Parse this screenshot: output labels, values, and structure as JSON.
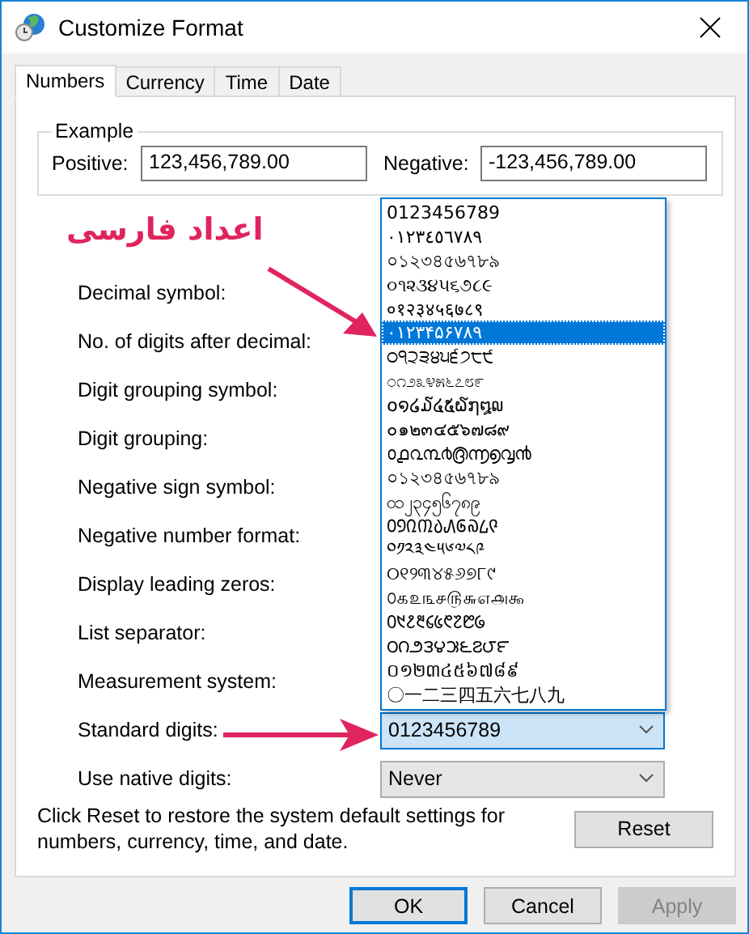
{
  "window": {
    "title": "Customize Format"
  },
  "tabs": [
    {
      "label": "Numbers",
      "selected": true
    },
    {
      "label": "Currency",
      "selected": false
    },
    {
      "label": "Time",
      "selected": false
    },
    {
      "label": "Date",
      "selected": false
    }
  ],
  "example": {
    "title": "Example",
    "positive_label": "Positive:",
    "positive_value": "123,456,789.00",
    "negative_label": "Negative:",
    "negative_value": "-123,456,789.00"
  },
  "settings": [
    {
      "label": "Decimal symbol:"
    },
    {
      "label": "No. of digits after decimal:"
    },
    {
      "label": "Digit grouping symbol:"
    },
    {
      "label": "Digit grouping:"
    },
    {
      "label": "Negative sign symbol:"
    },
    {
      "label": "Negative number format:"
    },
    {
      "label": "Display leading zeros:"
    },
    {
      "label": "List separator:"
    },
    {
      "label": "Measurement system:"
    },
    {
      "label": "Standard digits:",
      "value": "0123456789",
      "focused": true
    },
    {
      "label": "Use native digits:",
      "value": "Never",
      "focused": false
    }
  ],
  "digit_list": [
    {
      "text": "0123456789",
      "selected": false
    },
    {
      "text": "٠١٢٣٤٥٦٧٨٩",
      "selected": false
    },
    {
      "text": "০১২৩৪৫৬৭৮৯",
      "selected": false
    },
    {
      "text": "૦૧૨૩૪૫૬૭૮૯",
      "selected": false
    },
    {
      "text": "०१२३४५६७८९",
      "selected": false
    },
    {
      "text": "۰۱۲۳۴۵۶۷۸۹",
      "selected": true
    },
    {
      "text": "੦੧੨੩੪੫੬੭੮੯",
      "selected": false
    },
    {
      "text": "೦೧೨೩೪೫೬೭೮೯",
      "selected": false
    },
    {
      "text": "໐໑໒໓໔໕໖໗໘໙",
      "selected": false
    },
    {
      "text": "๐๑๒๓๔๕๖๗๘๙",
      "selected": false
    },
    {
      "text": "൦൧൨൩൪൫൬൭൮൯",
      "selected": false
    },
    {
      "text": "০১২৩৪৫৬৭৮৯",
      "selected": false
    },
    {
      "text": "၀၁၂၃၄၅၆၇၈၉",
      "selected": false
    },
    {
      "text": "᠐᠑᠒᠓᠔᠕᠖᠗᠘᠙",
      "selected": false
    },
    {
      "text": "༠༡༢༣༤༥༦༧༨༩",
      "selected": false
    },
    {
      "text": "୦୧୨୩୪୫୬୭୮୯",
      "selected": false
    },
    {
      "text": "௦௧௨௩௪௫௬௭௮௯",
      "selected": false
    },
    {
      "text": "᱐᱑᱒᱓᱔᱕᱖᱗᱘᱙",
      "selected": false
    },
    {
      "text": "౦౧౨౩౪౫౬౭౮౯",
      "selected": false
    },
    {
      "text": "០១២៣៤៥៦៧៨៩",
      "selected": false
    },
    {
      "text": "〇一二三四五六七八九",
      "selected": false
    }
  ],
  "reset_note": "Click Reset to restore the system default settings for numbers, currency, time, and date.",
  "reset_button": {
    "label": "Reset"
  },
  "buttons": [
    {
      "label": "OK",
      "kind": "default",
      "disabled": false
    },
    {
      "label": "Cancel",
      "kind": "normal",
      "disabled": false
    },
    {
      "label": "Apply",
      "kind": "normal",
      "disabled": true
    }
  ],
  "annotation": {
    "text": "اعداد فارسی"
  }
}
